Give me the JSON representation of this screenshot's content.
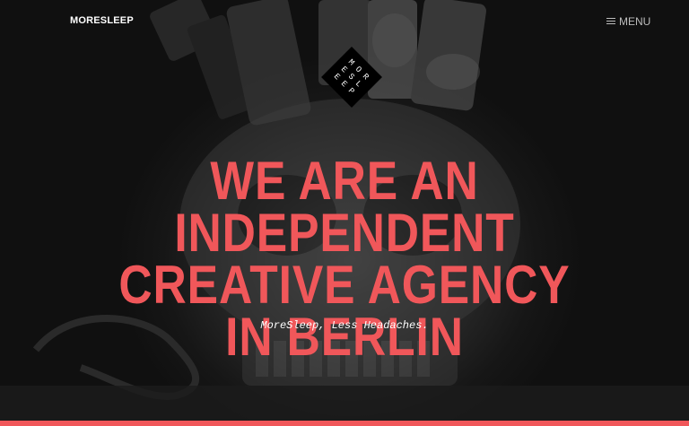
{
  "header": {
    "brand": "MORESLEEP",
    "menu_label": "MENU",
    "menu_icon": "hamburger-icon"
  },
  "logo": {
    "letters": [
      "M",
      "O",
      "R",
      "E",
      "S",
      "L",
      "E",
      "E",
      "P"
    ]
  },
  "hero": {
    "headline_lines": [
      "WE ARE AN INDEPENDENT",
      "CREATIVE AGENCY",
      "IN BERLIN"
    ],
    "tagline": "MoreSleep, Less Headaches."
  },
  "colors": {
    "accent": "#f0575a",
    "background": "#141414",
    "text": "#ffffff",
    "menu_text": "#bdbdbd"
  }
}
